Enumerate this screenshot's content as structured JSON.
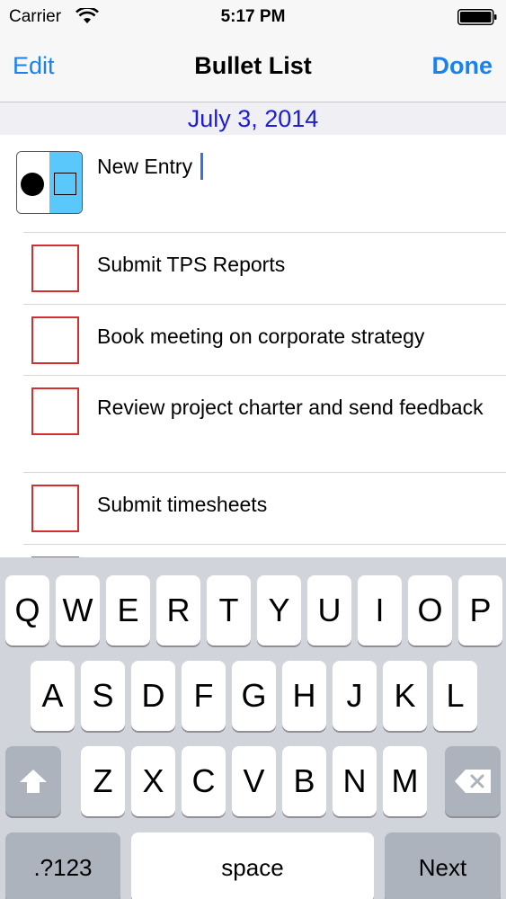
{
  "status_bar": {
    "carrier": "Carrier",
    "time": "5:17 PM"
  },
  "nav": {
    "edit_label": "Edit",
    "title": "Bullet List",
    "done_label": "Done"
  },
  "date_header": "July 3, 2014",
  "new_entry": {
    "value": "New Entry",
    "selected_type": "bullet"
  },
  "tasks": [
    {
      "text": "Submit TPS Reports",
      "status": "open",
      "color": "#d32f2f"
    },
    {
      "text": "Book meeting on corporate strategy",
      "status": "open",
      "color": "#d32f2f"
    },
    {
      "text": "Review project charter and send feedback",
      "status": "open",
      "color": "#d32f2f"
    },
    {
      "text": "Submit timesheets",
      "status": "open",
      "color": "#d32f2f"
    },
    {
      "text": "",
      "status": "partial",
      "color": "#2ea84a"
    }
  ],
  "keyboard": {
    "row1": [
      "Q",
      "W",
      "E",
      "R",
      "T",
      "Y",
      "U",
      "I",
      "O",
      "P"
    ],
    "row2": [
      "A",
      "S",
      "D",
      "F",
      "G",
      "H",
      "J",
      "K",
      "L"
    ],
    "row3": [
      "Z",
      "X",
      "C",
      "V",
      "B",
      "N",
      "M"
    ],
    "numbers_label": ".?123",
    "space_label": "space",
    "next_label": "Next"
  },
  "colors": {
    "accent_blue": "#1a82f0",
    "date_blue": "#1d1dd6",
    "toggle_blue": "#5ac8fa",
    "task_red": "#d32f2f",
    "task_green": "#2ea84a"
  }
}
